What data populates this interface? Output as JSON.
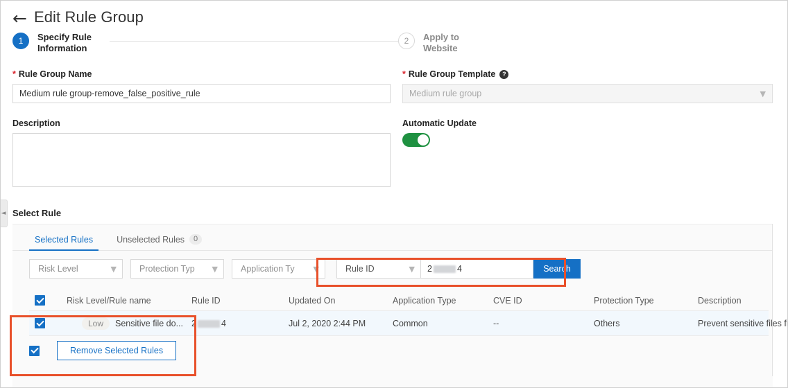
{
  "header": {
    "back_icon": "arrow-left-icon",
    "title": "Edit Rule Group"
  },
  "stepper": {
    "steps": [
      {
        "number": "1",
        "label": "Specify Rule Information",
        "state": "active"
      },
      {
        "number": "2",
        "label": "Apply to Website",
        "state": "inactive"
      }
    ]
  },
  "form": {
    "rule_group_name": {
      "label": "Rule Group Name",
      "required_marker": "*",
      "value": "Medium rule group-remove_false_positive_rule"
    },
    "description": {
      "label": "Description",
      "value": "",
      "placeholder": ""
    },
    "rule_group_template": {
      "label": "Rule Group Template",
      "required_marker": "*",
      "help_icon": "question-mark-icon",
      "value": "Medium rule group",
      "disabled": true,
      "chevron": "chevron-down-icon"
    },
    "automatic_update": {
      "label": "Automatic Update",
      "state": "on"
    }
  },
  "select_rule": {
    "section_title": "Select Rule",
    "collapse_handle_icon": "chevron-left-icon",
    "tabs": [
      {
        "label": "Selected Rules",
        "count": "",
        "active": true
      },
      {
        "label": "Unselected Rules",
        "count": "0",
        "active": false
      }
    ],
    "filters": [
      {
        "label": "Risk Level",
        "chevron": "chevron-down-icon"
      },
      {
        "label": "Protection Typ",
        "chevron": "chevron-down-icon"
      },
      {
        "label": "Application Ty",
        "chevron": "chevron-down-icon"
      }
    ],
    "search": {
      "type_label": "Rule ID",
      "type_chevron": "chevron-down-icon",
      "value_prefix": "2",
      "value_suffix": "4",
      "value_redacted": true,
      "button_label": "Search"
    },
    "table": {
      "select_all_checked": true,
      "columns": [
        "Risk Level/Rule name",
        "Rule ID",
        "Updated On",
        "Application Type",
        "CVE ID",
        "Protection Type",
        "Description"
      ],
      "rows": [
        {
          "checked": true,
          "risk_level": "Low",
          "rule_name": "Sensitive file do...",
          "rule_id_prefix": "2",
          "rule_id_suffix": "4",
          "rule_id_redacted": true,
          "updated_on": "Jul 2, 2020 2:44 PM",
          "application_type": "Common",
          "cve_id": "--",
          "protection_type": "Others",
          "description": "Prevent sensitive files fr..."
        }
      ]
    },
    "footer": {
      "select_all_checked": true,
      "remove_button_label": "Remove Selected Rules"
    }
  },
  "annotations": {
    "highlight_color": "#e8502a",
    "boxes": [
      "search-area-highlight",
      "selected-row-highlight"
    ]
  },
  "colors": {
    "accent_blue": "#1570c5",
    "toggle_green": "#1f9141",
    "required_red": "#d9232d",
    "row_highlight": "#f2f8fd"
  }
}
